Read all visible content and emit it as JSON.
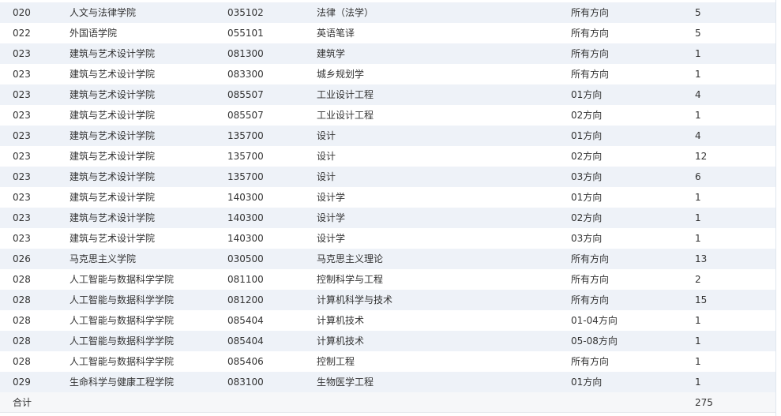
{
  "table": {
    "rows": [
      {
        "code": "020",
        "college": "人文与法律学院",
        "major_code": "035102",
        "major": "法律（法学）",
        "direction": "所有方向",
        "count": "5"
      },
      {
        "code": "022",
        "college": "外国语学院",
        "major_code": "055101",
        "major": "英语笔译",
        "direction": "所有方向",
        "count": "5"
      },
      {
        "code": "023",
        "college": "建筑与艺术设计学院",
        "major_code": "081300",
        "major": "建筑学",
        "direction": "所有方向",
        "count": "1"
      },
      {
        "code": "023",
        "college": "建筑与艺术设计学院",
        "major_code": "083300",
        "major": "城乡规划学",
        "direction": "所有方向",
        "count": "1"
      },
      {
        "code": "023",
        "college": "建筑与艺术设计学院",
        "major_code": "085507",
        "major": "工业设计工程",
        "direction": "01方向",
        "count": "4"
      },
      {
        "code": "023",
        "college": "建筑与艺术设计学院",
        "major_code": "085507",
        "major": "工业设计工程",
        "direction": "02方向",
        "count": "1"
      },
      {
        "code": "023",
        "college": "建筑与艺术设计学院",
        "major_code": "135700",
        "major": "设计",
        "direction": "01方向",
        "count": "4"
      },
      {
        "code": "023",
        "college": "建筑与艺术设计学院",
        "major_code": "135700",
        "major": "设计",
        "direction": "02方向",
        "count": "12"
      },
      {
        "code": "023",
        "college": "建筑与艺术设计学院",
        "major_code": "135700",
        "major": "设计",
        "direction": "03方向",
        "count": "6"
      },
      {
        "code": "023",
        "college": "建筑与艺术设计学院",
        "major_code": "140300",
        "major": "设计学",
        "direction": "01方向",
        "count": "1"
      },
      {
        "code": "023",
        "college": "建筑与艺术设计学院",
        "major_code": "140300",
        "major": "设计学",
        "direction": "02方向",
        "count": "1"
      },
      {
        "code": "023",
        "college": "建筑与艺术设计学院",
        "major_code": "140300",
        "major": "设计学",
        "direction": "03方向",
        "count": "1"
      },
      {
        "code": "026",
        "college": "马克思主义学院",
        "major_code": "030500",
        "major": "马克思主义理论",
        "direction": "所有方向",
        "count": "13"
      },
      {
        "code": "028",
        "college": "人工智能与数据科学学院",
        "major_code": "081100",
        "major": "控制科学与工程",
        "direction": "所有方向",
        "count": "2"
      },
      {
        "code": "028",
        "college": "人工智能与数据科学学院",
        "major_code": "081200",
        "major": "计算机科学与技术",
        "direction": "所有方向",
        "count": "15"
      },
      {
        "code": "028",
        "college": "人工智能与数据科学学院",
        "major_code": "085404",
        "major": "计算机技术",
        "direction": "01-04方向",
        "count": "1"
      },
      {
        "code": "028",
        "college": "人工智能与数据科学学院",
        "major_code": "085404",
        "major": "计算机技术",
        "direction": "05-08方向",
        "count": "1"
      },
      {
        "code": "028",
        "college": "人工智能与数据科学学院",
        "major_code": "085406",
        "major": "控制工程",
        "direction": "所有方向",
        "count": "1"
      },
      {
        "code": "029",
        "college": "生命科学与健康工程学院",
        "major_code": "083100",
        "major": "生物医学工程",
        "direction": "01方向",
        "count": "1"
      }
    ],
    "total": {
      "label": "合计",
      "count": "275"
    }
  }
}
